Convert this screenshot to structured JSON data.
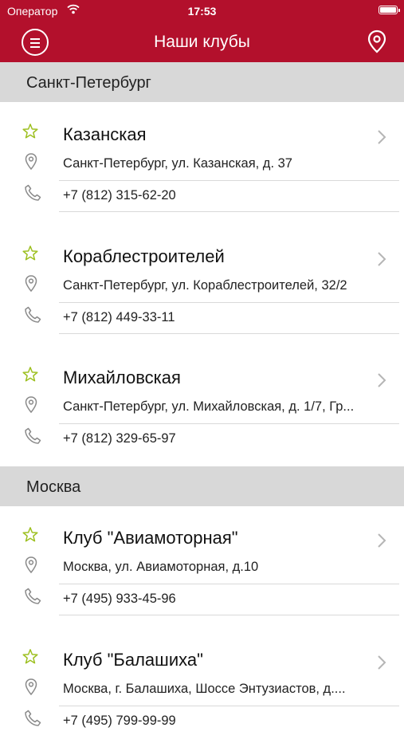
{
  "status_bar": {
    "carrier": "Оператор",
    "time": "17:53"
  },
  "header": {
    "title": "Наши клубы"
  },
  "colors": {
    "brand": "#b3102c",
    "star": "#9cbf1e",
    "icon": "#8a8a8a",
    "section_bg": "#d8d8d8"
  },
  "icons": {
    "menu": "hamburger-circle-icon",
    "map": "map-pin-icon",
    "favorite": "star-outline-icon",
    "address": "location-pin-icon",
    "phone": "phone-icon",
    "disclosure": "chevron-right-icon"
  },
  "sections": [
    {
      "title": "Санкт-Петербург",
      "clubs": [
        {
          "name": "Казанская",
          "address": "Санкт-Петербург, ул. Казанская, д. 37",
          "phone": "+7 (812) 315-62-20"
        },
        {
          "name": "Кораблестроителей",
          "address": "Санкт-Петербург, ул. Кораблестроителей, 32/2",
          "phone": "+7 (812) 449-33-11"
        },
        {
          "name": "Михайловская",
          "address": "Санкт-Петербург, ул. Михайловская, д. 1/7, Гр...",
          "phone": "+7 (812) 329-65-97"
        }
      ]
    },
    {
      "title": "Москва",
      "clubs": [
        {
          "name": "Клуб \"Авиамоторная\"",
          "address": "Москва, ул. Авиамоторная, д.10",
          "phone": "+7 (495) 933-45-96"
        },
        {
          "name": "Клуб \"Балашиха\"",
          "address": "Москва, г. Балашиха, Шоссе Энтузиастов, д....",
          "phone": "+7 (495) 799-99-99"
        }
      ]
    }
  ]
}
